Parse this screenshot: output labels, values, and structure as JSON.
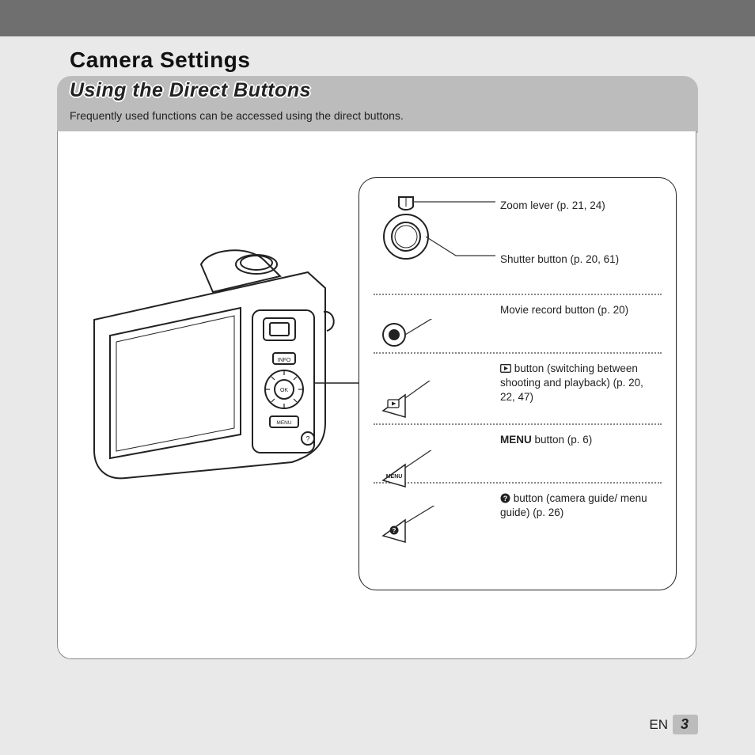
{
  "page_title": "Camera Settings",
  "subtitle": "Using the Direct Buttons",
  "intro": "Frequently used functions can be accessed using the direct buttons.",
  "callouts": {
    "zoom": "Zoom lever (p. 21, 24)",
    "shutter": "Shutter button (p. 20, 61)",
    "movie": "Movie record button (p. 20)",
    "playback": " button (switching between shooting and playback) (p. 20, 22, 47)",
    "menu_prefix": "MENU",
    "menu_rest": " button (p. 6)",
    "guide": " button (camera guide/ menu guide) (p. 26)"
  },
  "footer": {
    "lang": "EN",
    "page": "3"
  },
  "icons": {
    "playback": "playback-icon",
    "menu": "MENU",
    "guide": "?"
  }
}
